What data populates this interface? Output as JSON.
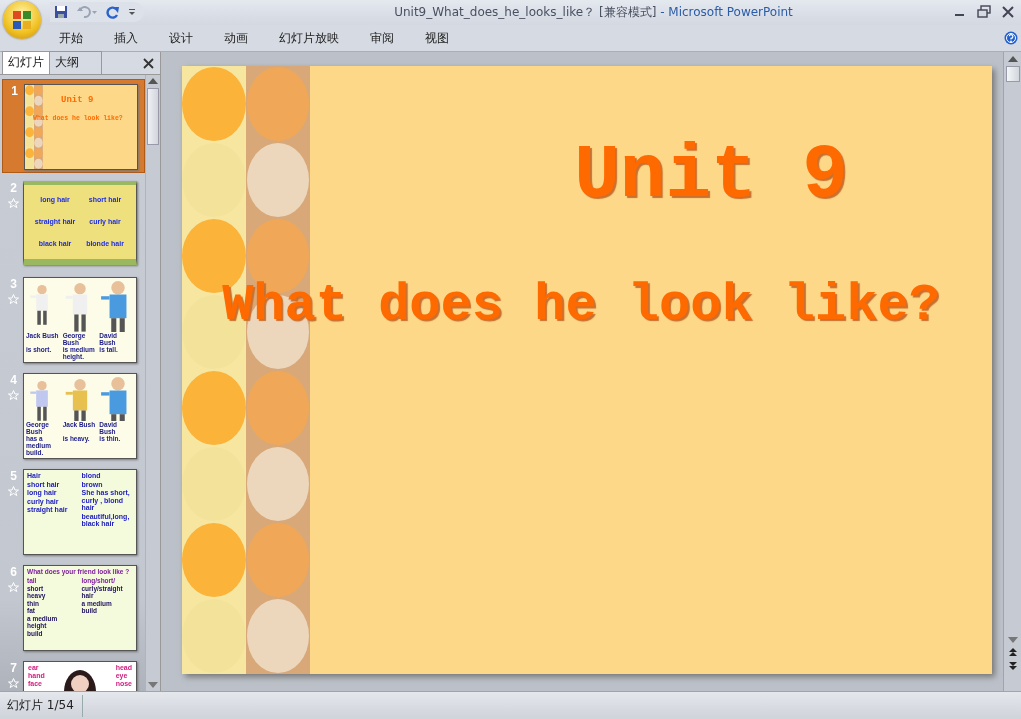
{
  "window": {
    "title": "Unit9_What_does_he_looks_like？ [兼容模式]",
    "app": "- Microsoft PowerPoint"
  },
  "ribbon_tabs": [
    {
      "label": "开始",
      "selected": false
    },
    {
      "label": "插入",
      "selected": false
    },
    {
      "label": "设计",
      "selected": false
    },
    {
      "label": "动画",
      "selected": false
    },
    {
      "label": "幻灯片放映",
      "selected": false
    },
    {
      "label": "审阅",
      "selected": false
    },
    {
      "label": "视图",
      "selected": false
    }
  ],
  "panel_tabs": [
    {
      "label": "幻灯片",
      "selected": true
    },
    {
      "label": "大纲",
      "selected": false
    }
  ],
  "slides": [
    {
      "number": "1",
      "selected": true,
      "animated": false,
      "kind": "title",
      "texts": [
        "Unit 9",
        "What does he look like?"
      ]
    },
    {
      "number": "2",
      "selected": false,
      "animated": true,
      "kind": "words",
      "texts": [
        "long hair",
        "short hair",
        "straight hair",
        "curly hair",
        "black hair",
        "blonde hair"
      ]
    },
    {
      "number": "3",
      "selected": false,
      "animated": true,
      "kind": "figures",
      "texts": [
        "Jack Bush",
        "George Bush",
        "David Bush",
        "is short.",
        "is medium height.",
        "is tall."
      ]
    },
    {
      "number": "4",
      "selected": false,
      "animated": true,
      "kind": "figures",
      "texts": [
        "George Bush",
        "Jack Bush",
        "David Bush",
        "has a medium build.",
        "is heavy.",
        "is thin."
      ]
    },
    {
      "number": "5",
      "selected": false,
      "animated": true,
      "kind": "vocab",
      "texts": [
        "Hair",
        "short hair",
        "long hair",
        "curly hair",
        "straight hair",
        "blond",
        "brown",
        "She has short, curly , blond hair",
        "beautiful,long, black hair"
      ]
    },
    {
      "number": "6",
      "selected": false,
      "animated": true,
      "kind": "table",
      "texts": [
        "What does your friend look like ?",
        "tall",
        "short",
        "heavy",
        "thin",
        "fat",
        "a medium",
        "height",
        "build",
        "long/short/",
        "curly/straight",
        "hair",
        "a medium",
        "build"
      ]
    },
    {
      "number": "7",
      "selected": false,
      "animated": true,
      "kind": "diagram",
      "texts": [
        "ear",
        "head",
        "hand",
        "eye",
        "face",
        "nose"
      ]
    }
  ],
  "current_slide": {
    "title": "Unit 9",
    "subtitle": "What does he look like?"
  },
  "status_bar": {
    "slide_indicator": "幻灯片 1/54"
  }
}
